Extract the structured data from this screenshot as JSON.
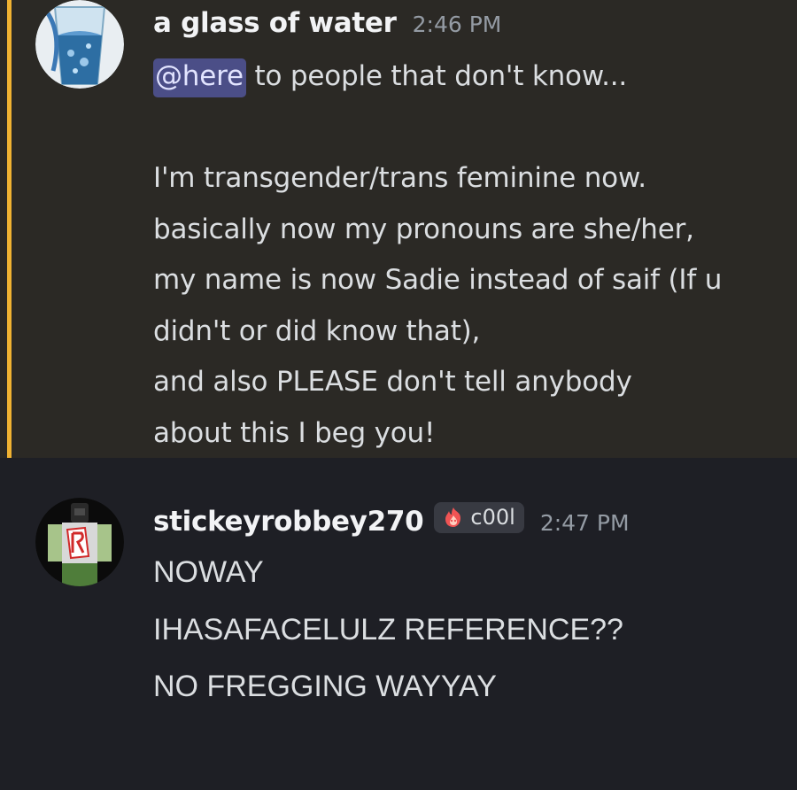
{
  "messages": [
    {
      "username": "a glass of water",
      "timestamp": "2:46 PM",
      "avatar_icon": "glass-of-water-avatar",
      "highlighted": true,
      "highlight_color": "#f0b232",
      "mention": "@here",
      "lines": [
        " to people that don't know...",
        "",
        "I'm transgender/trans feminine now.",
        "basically now my pronouns are she/her,",
        "my name is now Sadie instead of saif (If u",
        "didn't or did know that),",
        "and also PLEASE don't tell anybody",
        "about this I beg you!"
      ]
    },
    {
      "username": "stickeyrobbey270",
      "timestamp": "2:47 PM",
      "avatar_icon": "roblox-character-avatar",
      "role_tag": {
        "icon": "fire-icon",
        "label": "c00l"
      },
      "lines": [
        "NOWAY",
        "IHASAFACELULZ REFERENCE??",
        "NO FREGGING WAYYAY"
      ]
    }
  ],
  "colors": {
    "background": "#1e1f25",
    "highlight_background": "#2b2925",
    "mention_background": "#4b4e87",
    "username": "#f2f3f5",
    "text": "#dbdee1",
    "timestamp": "#949ba4"
  }
}
